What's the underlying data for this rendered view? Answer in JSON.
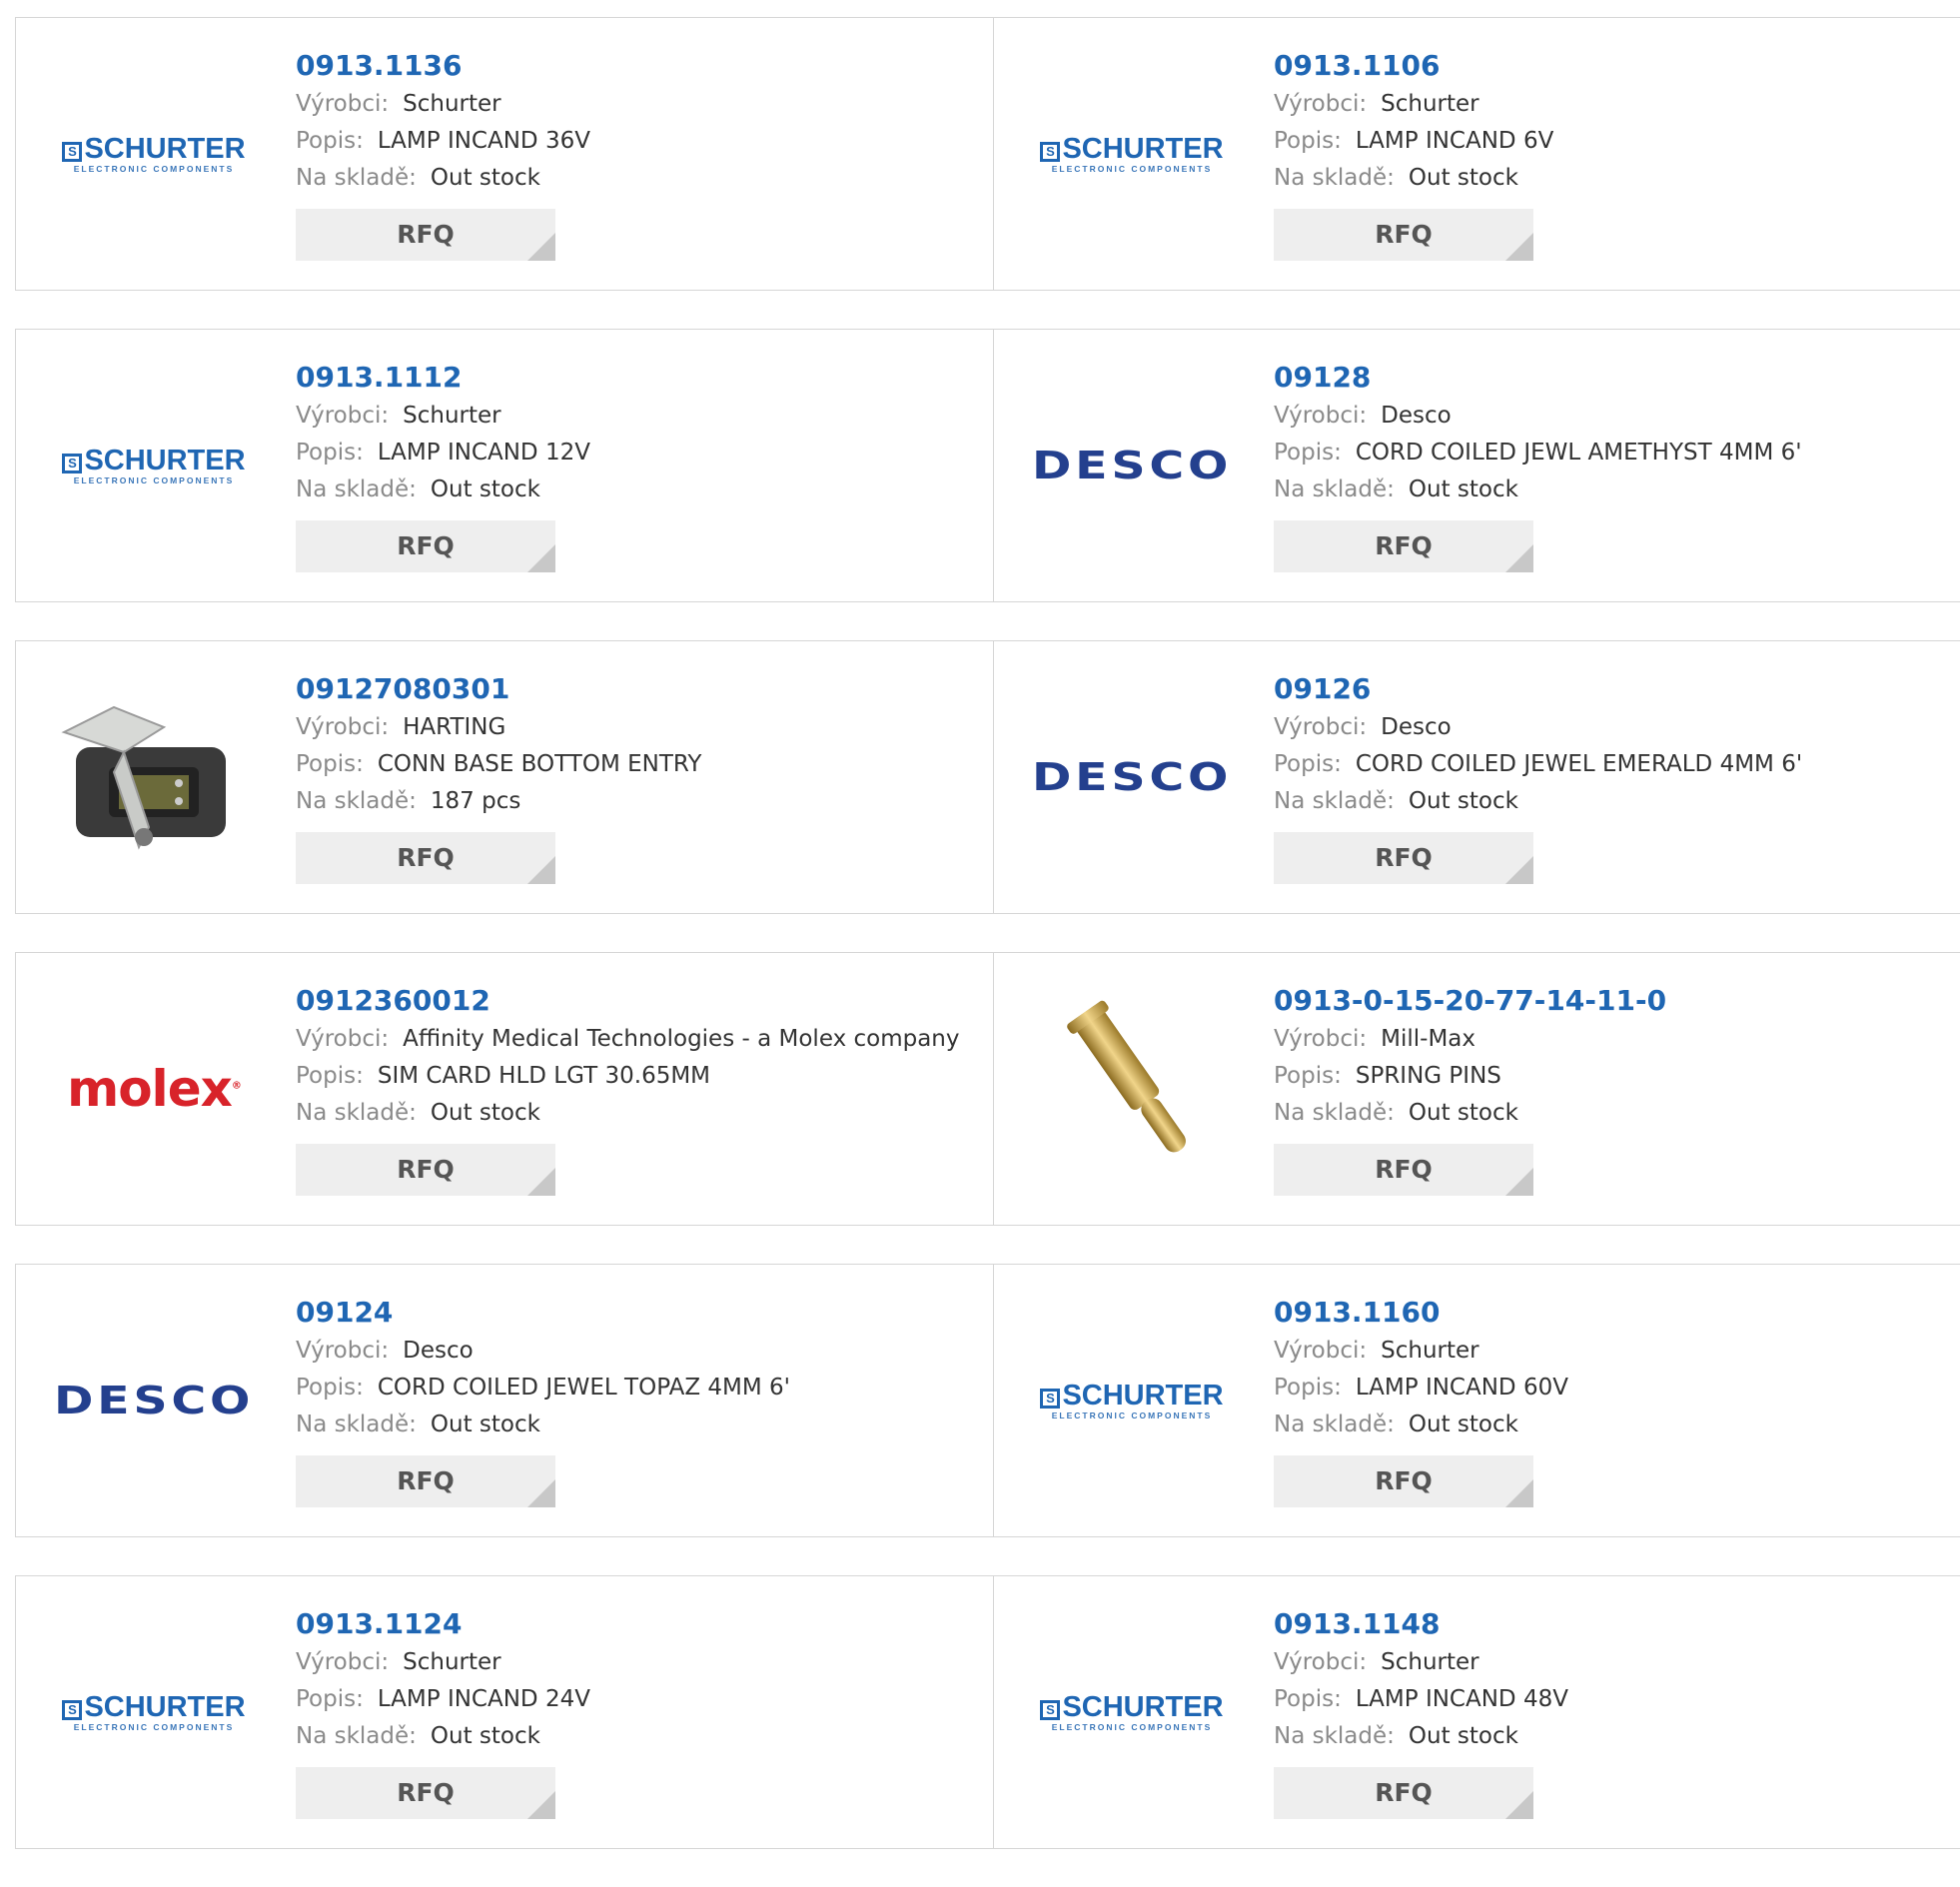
{
  "labels": {
    "manufacturer": "Výrobci:",
    "description": "Popis:",
    "stock": "Na skladě:",
    "rfq": "RFQ"
  },
  "colors": {
    "part_link": "#1f66b3",
    "label_gray": "#8a8a8a",
    "button_bg": "#eeeeee"
  },
  "products": [
    {
      "part": "0913.1136",
      "manufacturer": "Schurter",
      "description": "LAMP INCAND 36V",
      "stock": "Out stock",
      "logo": "schurter-logo",
      "logo_text": "SCHURTER",
      "logo_sub": "ELECTRONIC COMPONENTS"
    },
    {
      "part": "0913.1106",
      "manufacturer": "Schurter",
      "description": "LAMP INCAND 6V",
      "stock": "Out stock",
      "logo": "schurter-logo",
      "logo_text": "SCHURTER",
      "logo_sub": "ELECTRONIC COMPONENTS"
    },
    {
      "part": "0913.1112",
      "manufacturer": "Schurter",
      "description": "LAMP INCAND 12V",
      "stock": "Out stock",
      "logo": "schurter-logo",
      "logo_text": "SCHURTER",
      "logo_sub": "ELECTRONIC COMPONENTS"
    },
    {
      "part": "09128",
      "manufacturer": "Desco",
      "description": "CORD COILED JEWL AMETHYST 4MM 6'",
      "stock": "Out stock",
      "logo": "desco-logo",
      "logo_text": "DESCO"
    },
    {
      "part": "09127080301",
      "manufacturer": "HARTING",
      "description": "CONN BASE BOTTOM ENTRY",
      "stock": "187 pcs",
      "logo": "connector-housing-image"
    },
    {
      "part": "09126",
      "manufacturer": "Desco",
      "description": "CORD COILED JEWEL EMERALD 4MM 6'",
      "stock": "Out stock",
      "logo": "desco-logo",
      "logo_text": "DESCO"
    },
    {
      "part": "0912360012",
      "manufacturer": "Affinity Medical Technologies - a Molex company",
      "description": "SIM CARD HLD LGT 30.65MM",
      "stock": "Out stock",
      "logo": "molex-logo",
      "logo_text": "molex"
    },
    {
      "part": "0913-0-15-20-77-14-11-0",
      "manufacturer": "Mill-Max",
      "description": "SPRING PINS",
      "stock": "Out stock",
      "logo": "spring-pin-image"
    },
    {
      "part": "09124",
      "manufacturer": "Desco",
      "description": "CORD COILED JEWEL TOPAZ 4MM 6'",
      "stock": "Out stock",
      "logo": "desco-logo",
      "logo_text": "DESCO"
    },
    {
      "part": "0913.1160",
      "manufacturer": "Schurter",
      "description": "LAMP INCAND 60V",
      "stock": "Out stock",
      "logo": "schurter-logo",
      "logo_text": "SCHURTER",
      "logo_sub": "ELECTRONIC COMPONENTS"
    },
    {
      "part": "0913.1124",
      "manufacturer": "Schurter",
      "description": "LAMP INCAND 24V",
      "stock": "Out stock",
      "logo": "schurter-logo",
      "logo_text": "SCHURTER",
      "logo_sub": "ELECTRONIC COMPONENTS"
    },
    {
      "part": "0913.1148",
      "manufacturer": "Schurter",
      "description": "LAMP INCAND 48V",
      "stock": "Out stock",
      "logo": "schurter-logo",
      "logo_text": "SCHURTER",
      "logo_sub": "ELECTRONIC COMPONENTS"
    }
  ]
}
